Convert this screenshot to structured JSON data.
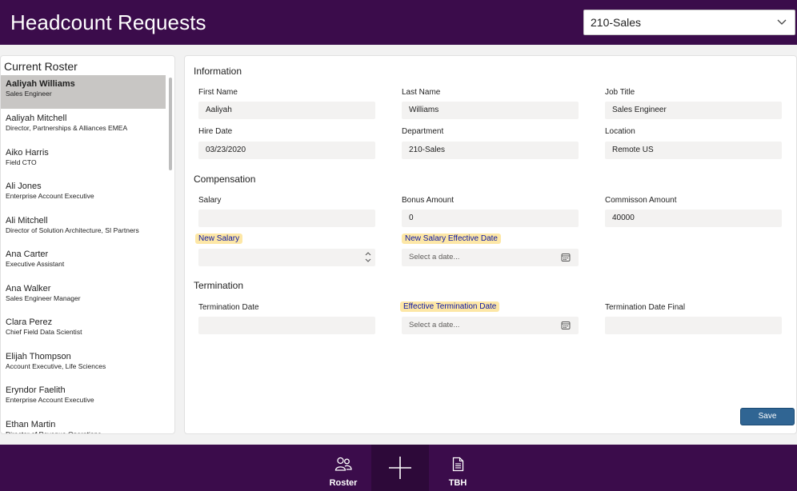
{
  "header": {
    "title": "Headcount Requests",
    "department_selected": "210-Sales"
  },
  "roster": {
    "title": "Current Roster",
    "items": [
      {
        "name": "Aaliyah Williams",
        "role": "Sales Engineer"
      },
      {
        "name": "Aaliyah Mitchell",
        "role": "Director, Partnerships & Alliances EMEA"
      },
      {
        "name": "Aiko Harris",
        "role": "Field CTO"
      },
      {
        "name": "Ali Jones",
        "role": "Enterprise Account Executive"
      },
      {
        "name": "Ali Mitchell",
        "role": "Director of Solution Architecture, SI Partners"
      },
      {
        "name": "Ana Carter",
        "role": "Executive Assistant"
      },
      {
        "name": "Ana Walker",
        "role": "Sales Engineer Manager"
      },
      {
        "name": "Clara Perez",
        "role": "Chief Field Data Scientist"
      },
      {
        "name": "Elijah Thompson",
        "role": "Account Executive, Life Sciences"
      },
      {
        "name": "Eryndor Faelith",
        "role": "Enterprise Account Executive"
      },
      {
        "name": "Ethan Martin",
        "role": "Director of Revenue Operations"
      }
    ]
  },
  "information": {
    "title": "Information",
    "first_name_label": "First Name",
    "first_name": "Aaliyah",
    "last_name_label": "Last Name",
    "last_name": "Williams",
    "job_title_label": "Job Title",
    "job_title": "Sales Engineer",
    "hire_date_label": "Hire Date",
    "hire_date": "03/23/2020",
    "department_label": "Department",
    "department": "210-Sales",
    "location_label": "Location",
    "location": "Remote US"
  },
  "compensation": {
    "title": "Compensation",
    "salary_label": "Salary",
    "salary": "",
    "bonus_label": "Bonus Amount",
    "bonus": "0",
    "commission_label": "Commisson Amount",
    "commission": "40000",
    "new_salary_label": "New Salary",
    "new_salary": "",
    "new_salary_date_label": "New Salary Effective Date",
    "new_salary_date_placeholder": "Select a date..."
  },
  "termination": {
    "title": "Termination",
    "termination_date_label": "Termination Date",
    "termination_date": "",
    "effective_termination_label": "Effective Termination Date",
    "effective_termination_placeholder": "Select a date...",
    "termination_final_label": "Termination Date Final",
    "termination_final": ""
  },
  "actions": {
    "save_label": "Save"
  },
  "footer": {
    "roster_label": "Roster",
    "tbh_label": "TBH"
  },
  "colors": {
    "header_bg": "#3b0c4b",
    "save_bg": "#306593",
    "highlight_bg": "#fde7a6",
    "highlight_text": "#0a16a3",
    "selected_row": "#c8c6c4"
  }
}
